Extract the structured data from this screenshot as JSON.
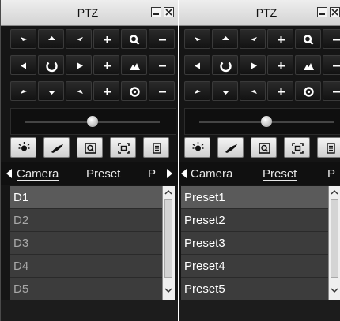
{
  "panels": [
    {
      "title": "PTZ",
      "tabs": [
        {
          "label": "Camera",
          "active": true
        },
        {
          "label": "Preset",
          "active": false
        },
        {
          "label": "P",
          "active": false
        }
      ],
      "list_items": [
        "D1",
        "D2",
        "D3",
        "D4",
        "D5"
      ],
      "selected_index": 0,
      "zoom_slider_level": 0.5
    },
    {
      "title": "PTZ",
      "tabs": [
        {
          "label": "Camera",
          "active": false
        },
        {
          "label": "Preset",
          "active": true
        },
        {
          "label": "P",
          "active": false
        }
      ],
      "list_items": [
        "Preset1",
        "Preset2",
        "Preset3",
        "Preset4",
        "Preset5"
      ],
      "selected_index": 0,
      "zoom_slider_level": 0.5
    }
  ],
  "ptz_controls": {
    "rows": [
      [
        "arrow-up-left-icon",
        "arrow-up-icon",
        "arrow-up-right-icon",
        "plus-icon",
        "zoom-magnifier-icon",
        "minus-icon"
      ],
      [
        "arrow-left-icon",
        "auto-rotate-icon",
        "arrow-right-icon",
        "plus-icon",
        "focus-mountain-icon",
        "minus-icon"
      ],
      [
        "arrow-down-left-icon",
        "arrow-down-icon",
        "arrow-down-right-icon",
        "plus-icon",
        "iris-icon",
        "minus-icon"
      ]
    ],
    "tools": [
      "light-bulb-icon",
      "wiper-icon",
      "zoom-area-icon",
      "center-focus-icon",
      "menu-list-icon"
    ]
  },
  "colors": {
    "panel_bg": "#151515",
    "list_bg": "#3c3c3c",
    "selected_row": "#5a5a5a",
    "text_bright": "#ffffff",
    "text_dim": "#a8a8a8",
    "title_bar": "#e0e0e0"
  }
}
